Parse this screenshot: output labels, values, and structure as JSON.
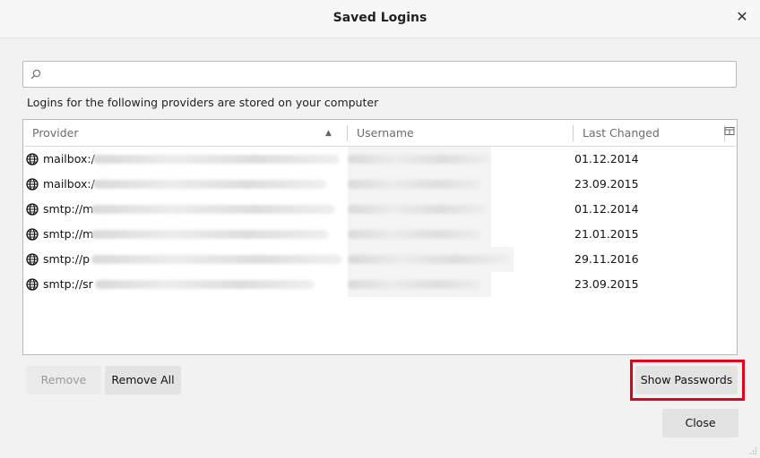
{
  "window": {
    "title": "Saved Logins",
    "close_glyph": "✕"
  },
  "search": {
    "placeholder": "",
    "value": ""
  },
  "description": "Logins for the following providers are stored on your computer",
  "table": {
    "columns": {
      "provider": "Provider",
      "username": "Username",
      "last_changed": "Last Changed"
    },
    "sort_indicator": "▲",
    "rows": [
      {
        "provider": "mailbox:/",
        "last_changed": "01.12.2014"
      },
      {
        "provider": "mailbox:/",
        "last_changed": "23.09.2015"
      },
      {
        "provider": "smtp://m",
        "last_changed": "01.12.2014"
      },
      {
        "provider": "smtp://m",
        "last_changed": "21.01.2015"
      },
      {
        "provider": "smtp://p",
        "last_changed": "29.11.2016"
      },
      {
        "provider": "smtp://sr",
        "last_changed": "23.09.2015"
      }
    ]
  },
  "buttons": {
    "remove": "Remove",
    "remove_all": "Remove All",
    "show_passwords": "Show Passwords",
    "close": "Close"
  },
  "colors": {
    "highlight": "#e0001b"
  },
  "icons": {
    "search": "search-icon",
    "globe": "globe-icon",
    "column_picker": "column-picker-icon",
    "resize_grip": "resize-grip-icon"
  }
}
